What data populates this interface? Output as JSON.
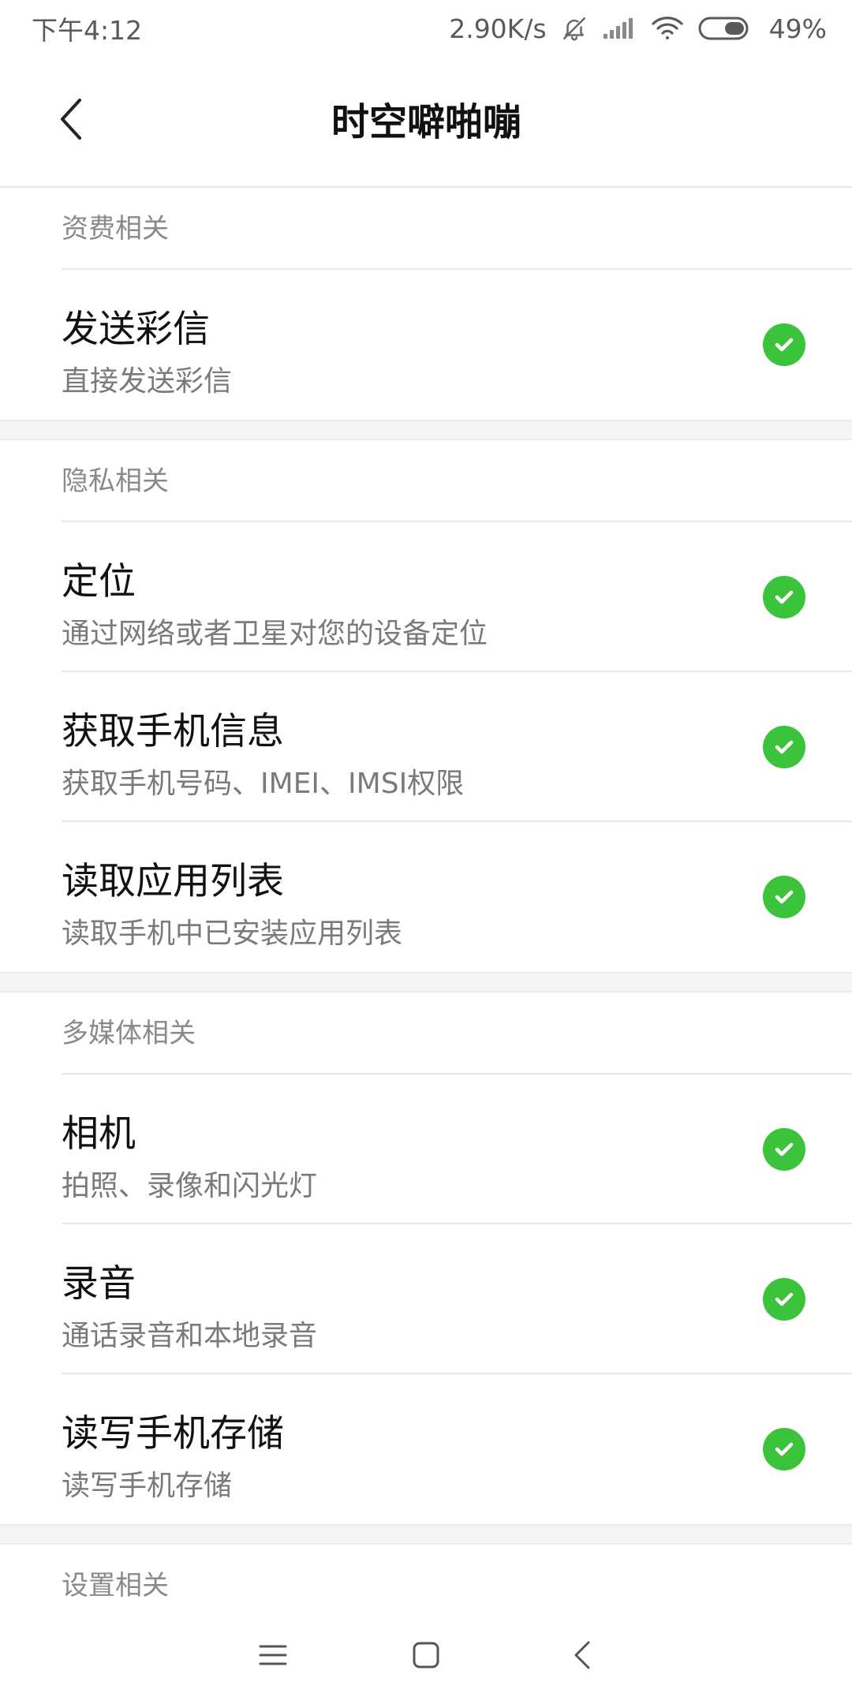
{
  "status_bar": {
    "time": "下午4:12",
    "network_speed": "2.90K/s",
    "battery": "49%",
    "icons": [
      "bell-off-icon",
      "signal-icon",
      "wifi-icon",
      "battery-icon"
    ]
  },
  "header": {
    "title": "时空噼啪嘣",
    "back_icon": "chevron-left-icon"
  },
  "sections": [
    {
      "title": "资费相关",
      "items": [
        {
          "title": "发送彩信",
          "subtitle": "直接发送彩信",
          "status_icon": "check-circle-icon"
        }
      ]
    },
    {
      "title": "隐私相关",
      "items": [
        {
          "title": "定位",
          "subtitle": "通过网络或者卫星对您的设备定位",
          "status_icon": "check-circle-icon"
        },
        {
          "title": "获取手机信息",
          "subtitle": "获取手机号码、IMEI、IMSI权限",
          "status_icon": "check-circle-icon"
        },
        {
          "title": "读取应用列表",
          "subtitle": "读取手机中已安装应用列表",
          "status_icon": "check-circle-icon"
        }
      ]
    },
    {
      "title": "多媒体相关",
      "items": [
        {
          "title": "相机",
          "subtitle": "拍照、录像和闪光灯",
          "status_icon": "check-circle-icon"
        },
        {
          "title": "录音",
          "subtitle": "通话录音和本地录音",
          "status_icon": "check-circle-icon"
        },
        {
          "title": "读写手机存储",
          "subtitle": "读写手机存储",
          "status_icon": "check-circle-icon"
        }
      ]
    },
    {
      "title": "设置相关",
      "items": []
    }
  ],
  "nav_bar": {
    "icons": [
      "menu-icon",
      "home-icon",
      "back-icon"
    ]
  },
  "colors": {
    "accent_green": "#3cc33c",
    "section_text": "#8a8a8a",
    "subtitle_text": "#7a7a7a"
  }
}
